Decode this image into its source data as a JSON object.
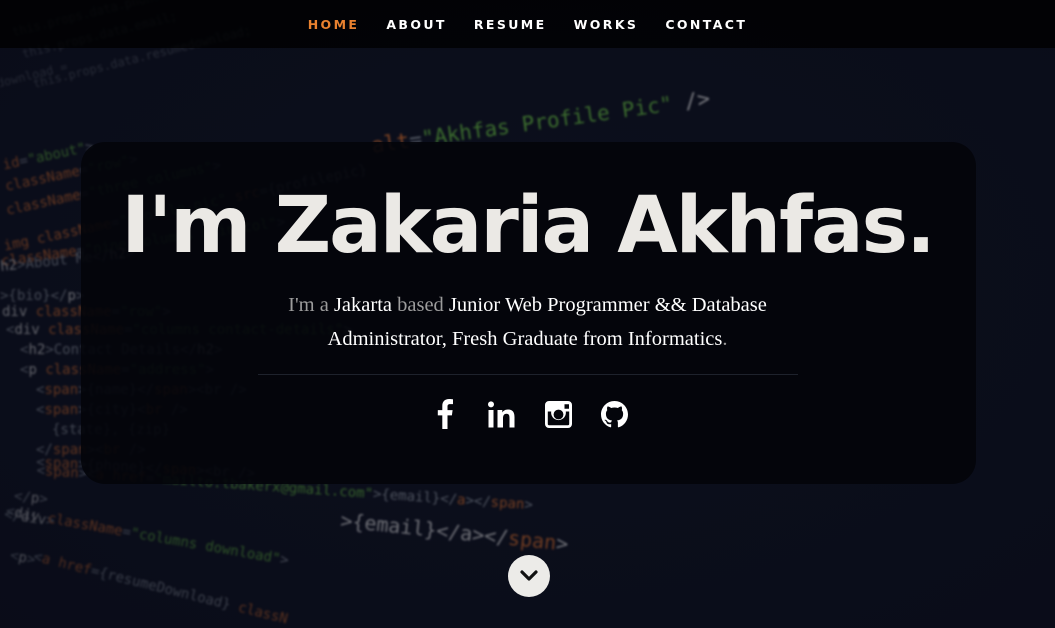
{
  "nav": {
    "items": [
      {
        "label": "HOME",
        "active": true
      },
      {
        "label": "ABOUT",
        "active": false
      },
      {
        "label": "RESUME",
        "active": false
      },
      {
        "label": "WORKS",
        "active": false
      },
      {
        "label": "CONTACT",
        "active": false
      }
    ]
  },
  "hero": {
    "title": "I'm Zakaria Akhfas.",
    "subtitle": {
      "p1": "I'm a ",
      "p2": "Jakarta",
      "p3": " based ",
      "p4": "Junior Web Programmer && Database Administrator, Fresh Graduate from Informatics",
      "p5": "."
    },
    "socials": [
      {
        "icon": "facebook-icon"
      },
      {
        "icon": "linkedin-icon"
      },
      {
        "icon": "instagram-icon"
      },
      {
        "icon": "github-icon"
      }
    ]
  },
  "scroll": {
    "icon": "chevron-down-icon"
  },
  "colors": {
    "accent": "#e8812f",
    "text": "#ebe9e5",
    "card_bg": "#03040a"
  }
}
